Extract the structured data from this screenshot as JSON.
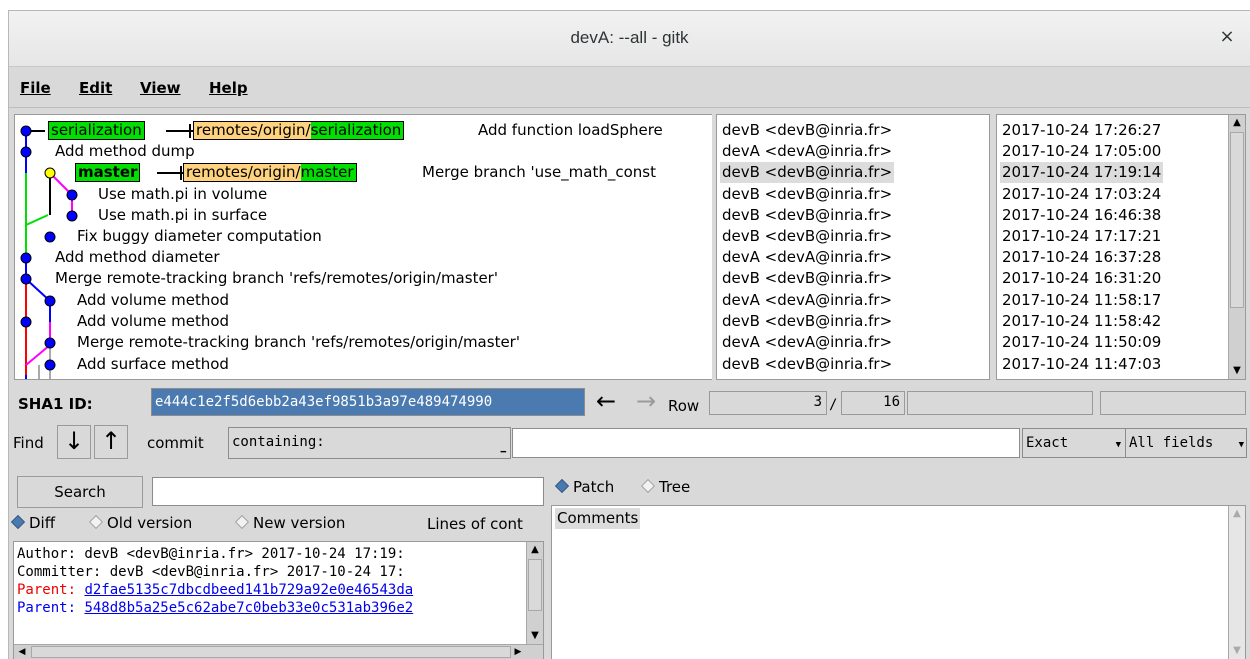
{
  "window": {
    "title": "devA: --all - gitk",
    "close_symbol": "×"
  },
  "menu": {
    "items": [
      "File",
      "Edit",
      "View",
      "Help"
    ]
  },
  "commits": [
    {
      "message": "Add function loadSphere",
      "author": "devB <devB@inria.fr>",
      "date": "2017-10-24 17:26:27",
      "refs": [
        {
          "name": "serialization",
          "kind": "head"
        },
        {
          "prefix": "remotes/origin/",
          "name": "serialization",
          "kind": "remote"
        }
      ]
    },
    {
      "message": "Add method dump",
      "author": "devA <devA@inria.fr>",
      "date": "2017-10-24 17:05:00"
    },
    {
      "message": "Merge branch 'use_math_const",
      "author": "devB <devB@inria.fr>",
      "date": "2017-10-24 17:19:14",
      "selected": true,
      "refs": [
        {
          "name": "master",
          "kind": "current"
        },
        {
          "prefix": "remotes/origin/",
          "name": "master",
          "kind": "remote"
        }
      ]
    },
    {
      "message": "Use math.pi in volume",
      "author": "devB <devB@inria.fr>",
      "date": "2017-10-24 17:03:24"
    },
    {
      "message": "Use math.pi in surface",
      "author": "devB <devB@inria.fr>",
      "date": "2017-10-24 16:46:38"
    },
    {
      "message": "Fix buggy diameter computation",
      "author": "devB <devB@inria.fr>",
      "date": "2017-10-24 17:17:21"
    },
    {
      "message": "Add method diameter",
      "author": "devA <devA@inria.fr>",
      "date": "2017-10-24 16:37:28"
    },
    {
      "message": "Merge remote-tracking branch 'refs/remotes/origin/master'",
      "author": "devB <devB@inria.fr>",
      "date": "2017-10-24 16:31:20"
    },
    {
      "message": "Add volume method",
      "author": "devA <devA@inria.fr>",
      "date": "2017-10-24 11:58:17"
    },
    {
      "message": "Add volume method",
      "author": "devB <devB@inria.fr>",
      "date": "2017-10-24 11:58:42"
    },
    {
      "message": "Merge remote-tracking branch 'refs/remotes/origin/master'",
      "author": "devA <devA@inria.fr>",
      "date": "2017-10-24 11:50:09"
    },
    {
      "message": "Add surface method",
      "author": "devB <devB@inria.fr>",
      "date": "2017-10-24 11:47:03"
    }
  ],
  "sha1": {
    "label": "SHA1 ID:",
    "value": "e444c1e2f5d6ebb2a43ef9851b3a97e489474990"
  },
  "rowinfo": {
    "label": "Row",
    "current": "3",
    "total": "16"
  },
  "find": {
    "label": "Find",
    "type": "commit",
    "mode": "containing:",
    "match": "Exact",
    "fields": "All fields"
  },
  "search": {
    "button": "Search"
  },
  "diffmode": {
    "diff": "Diff",
    "old": "Old version",
    "new": "New version",
    "lines": "Lines of cont"
  },
  "view": {
    "patch": "Patch",
    "tree": "Tree",
    "comments": "Comments"
  },
  "details": {
    "author": "Author: devB <devB@inria.fr>  2017-10-24 17:19:",
    "committer": "Committer: devB <devB@inria.fr>  2017-10-24 17:",
    "parent_label": "Parent:",
    "parent1": "d2fae5135c7dbcdbeed141b729a92e0e46543da",
    "parent2": "548d8b5a25e5c62abe7c0beb33e0c531ab396e2"
  }
}
